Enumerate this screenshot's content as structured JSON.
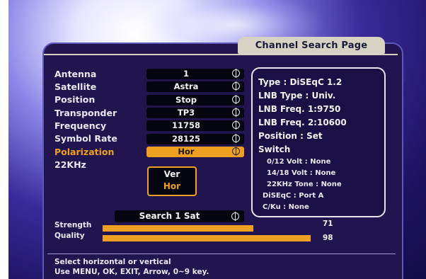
{
  "page_title": "Channel Search Page",
  "settings": [
    {
      "label": "Antenna",
      "value": "1",
      "icon": "circle-arrows-icon"
    },
    {
      "label": "Satellite",
      "value": "Astra",
      "icon": "circle-arrows-icon"
    },
    {
      "label": "Position",
      "value": "Stop",
      "icon": "circle-arrows-icon"
    },
    {
      "label": "Transponder",
      "value": "TP3",
      "icon": "circle-arrows-icon"
    },
    {
      "label": "Frequency",
      "value": "11758",
      "icon": "numeric-input-icon"
    },
    {
      "label": "Symbol Rate",
      "value": "28125",
      "icon": "numeric-input-icon"
    },
    {
      "label": "Polarization",
      "value": "Hor",
      "icon": "circle-arrows-icon",
      "selected": true
    },
    {
      "label": "22KHz",
      "value": ""
    }
  ],
  "polarization_options": {
    "selected": "Hor",
    "items": [
      "Ver",
      "Hor"
    ]
  },
  "info": {
    "type": "Type : DiSEqC 1.2",
    "lnb_type": "LNB Type : Univ.",
    "lnb_freq1": "LNB Freq. 1:9750",
    "lnb_freq2": "LNB Freq. 2:10600",
    "position": "Position : Set",
    "switch_title": "Switch",
    "switch_items": [
      "0/12 Volt : None",
      "14/18 Volt : None",
      "22KHz Tone : None",
      "DiSEqC : Port A",
      "C/Ku : None"
    ]
  },
  "search_button": "Search 1 Sat",
  "signal": {
    "strength": {
      "label": "Strength",
      "value": 71
    },
    "quality": {
      "label": "Quality",
      "value": 98
    }
  },
  "help": {
    "line1": "Select horizontal or vertical",
    "line2": "Use MENU, OK, EXIT, Arrow, 0~9 key."
  },
  "colors": {
    "accent": "#f0a020",
    "panel": "#22144f",
    "value_box": "#050510",
    "title_bar": "#d6d3c4"
  }
}
